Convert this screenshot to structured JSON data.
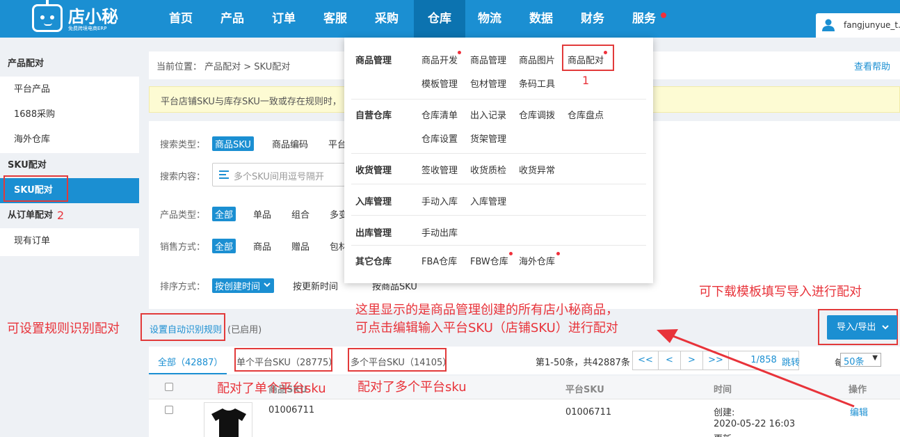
{
  "header": {
    "logo_text": "店小秘",
    "logo_sub": "免费跨境电商ERP",
    "nav": [
      "首页",
      "产品",
      "订单",
      "客服",
      "采购",
      "仓库",
      "物流",
      "数据",
      "财务",
      "服务"
    ],
    "user": "fangjunyue_t..."
  },
  "sidebar": {
    "groups": [
      {
        "title": "产品配对",
        "items": [
          "平台产品",
          "1688采购",
          "海外仓库"
        ]
      },
      {
        "title": "SKU配对",
        "items": [
          "SKU配对"
        ]
      },
      {
        "title": "从订单配对",
        "items": [
          "现有订单"
        ]
      }
    ]
  },
  "breadcrumb": {
    "text": "当前位置：  产品配对 > SKU配对",
    "help": "查看帮助"
  },
  "notice": "平台店铺SKU与库存SKU一致或存在规则时，",
  "filters": {
    "search_type_label": "搜索类型：",
    "search_type_options": [
      "商品SKU",
      "商品编码",
      "平台"
    ],
    "search_content_label": "搜索内容：",
    "search_placeholder": "多个SKU间用逗号隔开",
    "product_type_label": "产品类型：",
    "product_type_options": [
      "全部",
      "单品",
      "组合",
      "多变"
    ],
    "sale_label": "销售方式：",
    "sale_options": [
      "全部",
      "商品",
      "赠品",
      "包材"
    ],
    "sort_label": "排序方式：",
    "sort_options": [
      "按创建时间",
      "按更新时间",
      "按商品SKU"
    ]
  },
  "rules": {
    "link": "设置自动识别规则",
    "status": "(已启用)"
  },
  "import_export": "导入/导出",
  "tabs": [
    "全部（42887）",
    "单个平台SKU（28775）",
    "多个平台SKU（14105）"
  ],
  "pagination": {
    "summary": "第1-50条，共42887条",
    "first": "<<",
    "prev": "<",
    "next": ">",
    "last": ">>",
    "page": "1/858",
    "jump": "跳转",
    "per_page_label": "每页",
    "per_page": "50条"
  },
  "table": {
    "headers": [
      "商品SKU",
      "平台SKU",
      "时间",
      "操作"
    ],
    "rows": [
      {
        "sku": "01006711",
        "platform_sku": "01006711",
        "time_label": "创建:",
        "time": "2020-05-22 16:03",
        "time_label2": "更新:",
        "action": "编辑"
      }
    ]
  },
  "dropdown": {
    "sections": [
      {
        "title": "商品管理",
        "items": [
          [
            "商品开发",
            "商品管理",
            "商品图片",
            "商品配对"
          ],
          [
            "模板管理",
            "包材管理",
            "条码工具"
          ]
        ]
      },
      {
        "title": "自营仓库",
        "items": [
          [
            "仓库清单",
            "出入记录",
            "仓库调拨",
            "仓库盘点"
          ],
          [
            "仓库设置",
            "货架管理"
          ]
        ]
      },
      {
        "title": "收货管理",
        "items": [
          [
            "签收管理",
            "收货质检",
            "收货异常"
          ]
        ]
      },
      {
        "title": "入库管理",
        "items": [
          [
            "手动入库",
            "入库管理"
          ]
        ]
      },
      {
        "title": "出库管理",
        "items": [
          [
            "手动出库"
          ]
        ]
      },
      {
        "title": "其它仓库",
        "items": [
          [
            "FBA仓库",
            "FBW仓库",
            "海外仓库"
          ]
        ]
      }
    ]
  },
  "annotations": {
    "n1": "1",
    "n2": "2",
    "download": "可下载模板填写导入进行配对",
    "rules": "可设置规则识别配对",
    "note_line1": "这里显示的是商品管理创建的所有店小秘商品，",
    "note_line2": "可点击编辑输入平台SKU（店铺SKU）进行配对",
    "single": "配对了单个平台sku",
    "multi": "配对了多个平台sku"
  },
  "colors": {
    "primary": "#1b8fd2",
    "nav_active": "#0c73b0",
    "annotation": "#e8333a",
    "notice_bg": "#fdfbd3"
  }
}
